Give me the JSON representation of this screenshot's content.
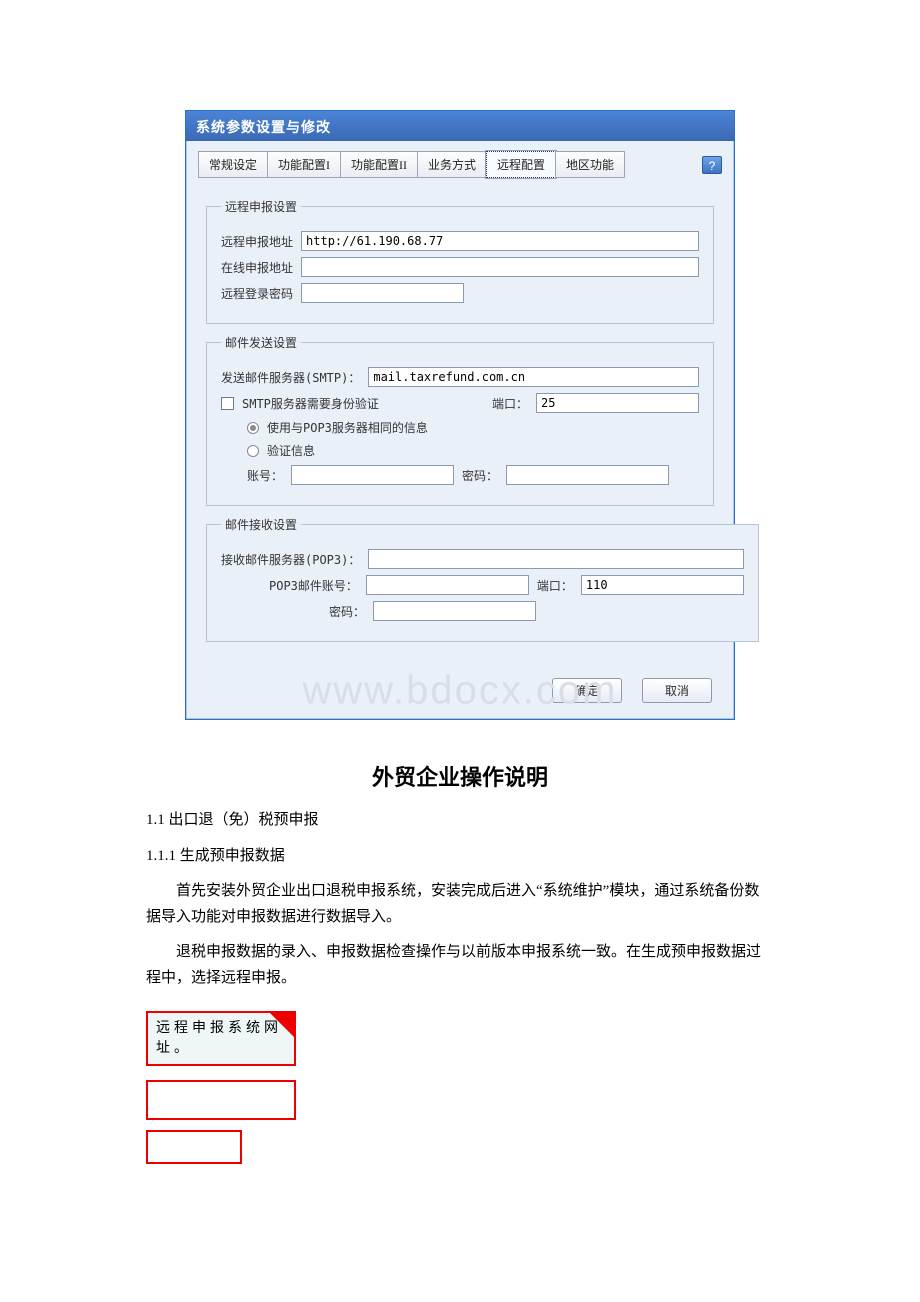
{
  "dialog": {
    "title": "系统参数设置与修改",
    "tabs": [
      "常规设定",
      "功能配置I",
      "功能配置II",
      "业务方式",
      "远程配置",
      "地区功能"
    ],
    "activeTab": 4,
    "help": "?"
  },
  "remote": {
    "legend": "远程申报设置",
    "addrLabel": "远程申报地址",
    "addrValue": "http://61.190.68.77",
    "onlineLabel": "在线申报地址",
    "onlineValue": "",
    "pwLabel": "远程登录密码",
    "pwValue": ""
  },
  "smtp": {
    "legend": "邮件发送设置",
    "serverLabel": "发送邮件服务器(SMTP)：",
    "serverValue": "mail.taxrefund.com.cn",
    "authLabel": "SMTP服务器需要身份验证",
    "portLabel": "端口：",
    "portValue": "25",
    "opt1": "使用与POP3服务器相同的信息",
    "opt2": "验证信息",
    "acctLabel": "账号：",
    "acctValue": "",
    "pwdLabel": "密码：",
    "pwdValue": ""
  },
  "pop3": {
    "legend": "邮件接收设置",
    "serverLabel": "接收邮件服务器(POP3)：",
    "serverValue": "",
    "acctLabel": "POP3邮件账号：",
    "acctValue": "",
    "portLabel": "端口：",
    "portValue": "110",
    "pwdLabel": "密码：",
    "pwdValue": ""
  },
  "buttons": {
    "ok": "确定",
    "cancel": "取消"
  },
  "watermark": "www.bdocx.com",
  "doc": {
    "heading": "外贸企业操作说明",
    "sec1": "1.1  出口退（免）税预申报",
    "sec2": "1.1.1       生成预申报数据",
    "para1": "首先安装外贸企业出口退税申报系统，安装完成后进入“系统维护”模块，通过系统备份数据导入功能对申报数据进行数据导入。",
    "para2": "退税申报数据的录入、申报数据检查操作与以前版本申报系统一致。在生成预申报数据过程中，选择远程申报。"
  },
  "callout": {
    "text": "远程申报系统网址。"
  }
}
